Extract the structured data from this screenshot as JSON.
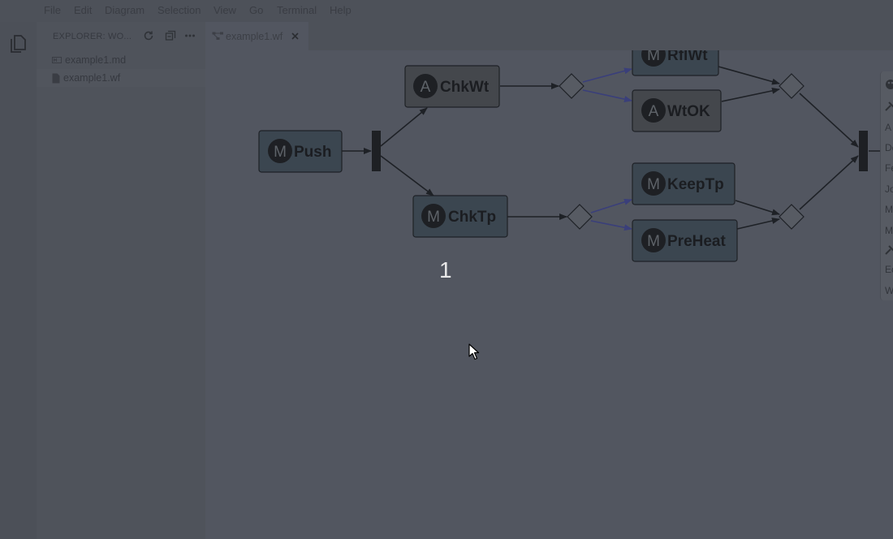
{
  "menu": {
    "items": [
      {
        "label": "File"
      },
      {
        "label": "Edit"
      },
      {
        "label": "Diagram"
      },
      {
        "label": "Selection"
      },
      {
        "label": "View"
      },
      {
        "label": "Go"
      },
      {
        "label": "Terminal"
      },
      {
        "label": "Help"
      }
    ]
  },
  "activitybar": {
    "explorer_icon": "files-icon"
  },
  "sidebar": {
    "title": "EXPLORER: WO...",
    "actions": [
      "refresh-icon",
      "collapse-all-icon",
      "more-icon"
    ],
    "files": [
      {
        "name": "example1.md",
        "icon": "markdown-file-icon"
      },
      {
        "name": "example1.wf",
        "icon": "file-icon"
      }
    ]
  },
  "editor": {
    "tab": {
      "label": "example1.wf",
      "icon": "diagram-icon",
      "close": "close-icon"
    }
  },
  "diagram": {
    "nodes": [
      {
        "id": "push",
        "badge": "M",
        "label": "Push",
        "kind": "manual"
      },
      {
        "id": "chkwt",
        "badge": "A",
        "label": "ChkWt",
        "kind": "automated"
      },
      {
        "id": "chktp",
        "badge": "M",
        "label": "ChkTp",
        "kind": "manual"
      },
      {
        "id": "rflwt",
        "badge": "M",
        "label": "RflWt",
        "kind": "manual"
      },
      {
        "id": "wtok",
        "badge": "A",
        "label": "WtOK",
        "kind": "automated"
      },
      {
        "id": "keeptp",
        "badge": "M",
        "label": "KeepTp",
        "kind": "manual"
      },
      {
        "id": "preheat",
        "badge": "M",
        "label": "PreHeat",
        "kind": "manual"
      }
    ]
  },
  "palette": {
    "items": [
      {
        "label": "A"
      },
      {
        "label": "De"
      },
      {
        "label": "Fe"
      },
      {
        "label": "Jo"
      },
      {
        "label": "M"
      },
      {
        "label": "M"
      },
      {
        "label": "Ec"
      },
      {
        "label": "W"
      }
    ]
  },
  "overlay": {
    "step_label": "1"
  },
  "colors": {
    "task_manual": "#3b4650",
    "task_automated": "#44474c",
    "badge": "#1e2024",
    "edge": "#1e2126",
    "weighted_edge": "#3a3f7a"
  }
}
